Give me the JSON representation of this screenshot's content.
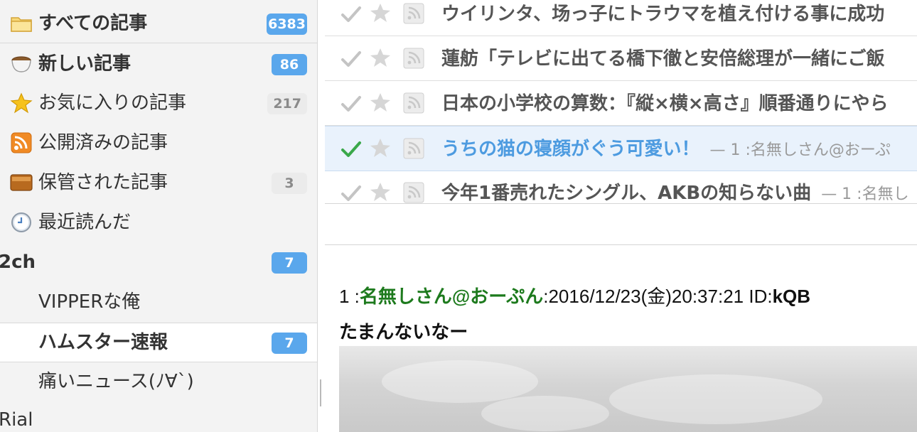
{
  "sidebar": {
    "items": [
      {
        "label": "すべての記事",
        "count": "6383",
        "icon": "folder-icon",
        "style": "bold"
      },
      {
        "label": "新しい記事",
        "count": "86",
        "icon": "coffee-cup-icon",
        "style": "bold"
      },
      {
        "label": "お気に入りの記事",
        "count": "217",
        "icon": "star-icon",
        "style": "normal"
      },
      {
        "label": "公開済みの記事",
        "count": "",
        "icon": "rss-icon",
        "style": "normal"
      },
      {
        "label": "保管された記事",
        "count": "3",
        "icon": "archive-box-icon",
        "style": "normal"
      },
      {
        "label": "最近読んだ",
        "count": "",
        "icon": "clock-icon",
        "style": "normal"
      }
    ],
    "groups": [
      {
        "label": "2ch",
        "count": "7",
        "feeds": [
          {
            "label": "VIPPERな俺",
            "count": ""
          },
          {
            "label": "ハムスター速報",
            "count": "7",
            "selected": true
          },
          {
            "label": "痛いニュース(ﾉ∀`)",
            "count": ""
          }
        ]
      },
      {
        "label": "Rial",
        "count": ""
      }
    ]
  },
  "articles": [
    {
      "title": "ウイリンタ、场っ子にトラウマを植え付ける事に成功",
      "excerpt": ""
    },
    {
      "title": "蓮舫「テレビに出てる橋下徹と安倍総理が一緒にご飯",
      "excerpt": ""
    },
    {
      "title": "日本の小学校の算数：『縦×横×高さ』順番通りにやら",
      "excerpt": ""
    },
    {
      "title": "うちの猫の寝顔がぐう可愛い！",
      "excerpt": "— 1 :名無しさん@おーぷ",
      "active": true
    },
    {
      "title": "今年1番売れたシングル、AKBの知らない曲",
      "excerpt": "— 1 :名無し",
      "active": false
    }
  ],
  "content": {
    "post_number": "1 :",
    "post_name": "名無しさん@おーぷん",
    "post_date": ":2016/12/23(金)20:37:21 ID:",
    "post_id": "kQB",
    "post_body": "たまんないなー"
  },
  "colors": {
    "accent": "#5aa7ec",
    "active_title": "#4d9be0",
    "name_green": "#1d7a1d"
  }
}
